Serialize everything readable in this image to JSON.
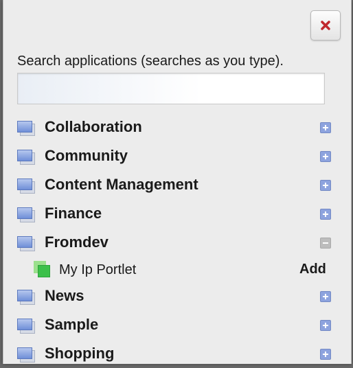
{
  "dialog": {
    "close_icon": "close-icon",
    "close_color": "#c0282d"
  },
  "search": {
    "label": "Search applications (searches as you type).",
    "value": "",
    "placeholder": ""
  },
  "categories": [
    {
      "label": "Collaboration",
      "state": "collapsed",
      "icon": "folder-icon"
    },
    {
      "label": "Community",
      "state": "collapsed",
      "icon": "folder-icon"
    },
    {
      "label": "Content Management",
      "state": "collapsed",
      "icon": "folder-icon"
    },
    {
      "label": "Finance",
      "state": "collapsed",
      "icon": "folder-icon"
    },
    {
      "label": "Fromdev",
      "state": "expanded",
      "icon": "folder-icon",
      "applications": [
        {
          "label": "My Ip Portlet",
          "action": "Add",
          "icon": "portlet-icon"
        }
      ]
    },
    {
      "label": "News",
      "state": "collapsed",
      "icon": "folder-icon"
    },
    {
      "label": "Sample",
      "state": "collapsed",
      "icon": "folder-icon"
    },
    {
      "label": "Shopping",
      "state": "collapsed",
      "icon": "folder-icon"
    }
  ],
  "colors": {
    "expand_icon": "#8da3de",
    "collapse_icon": "#bdbdbd",
    "portlet_icon": "#3cc04a"
  }
}
